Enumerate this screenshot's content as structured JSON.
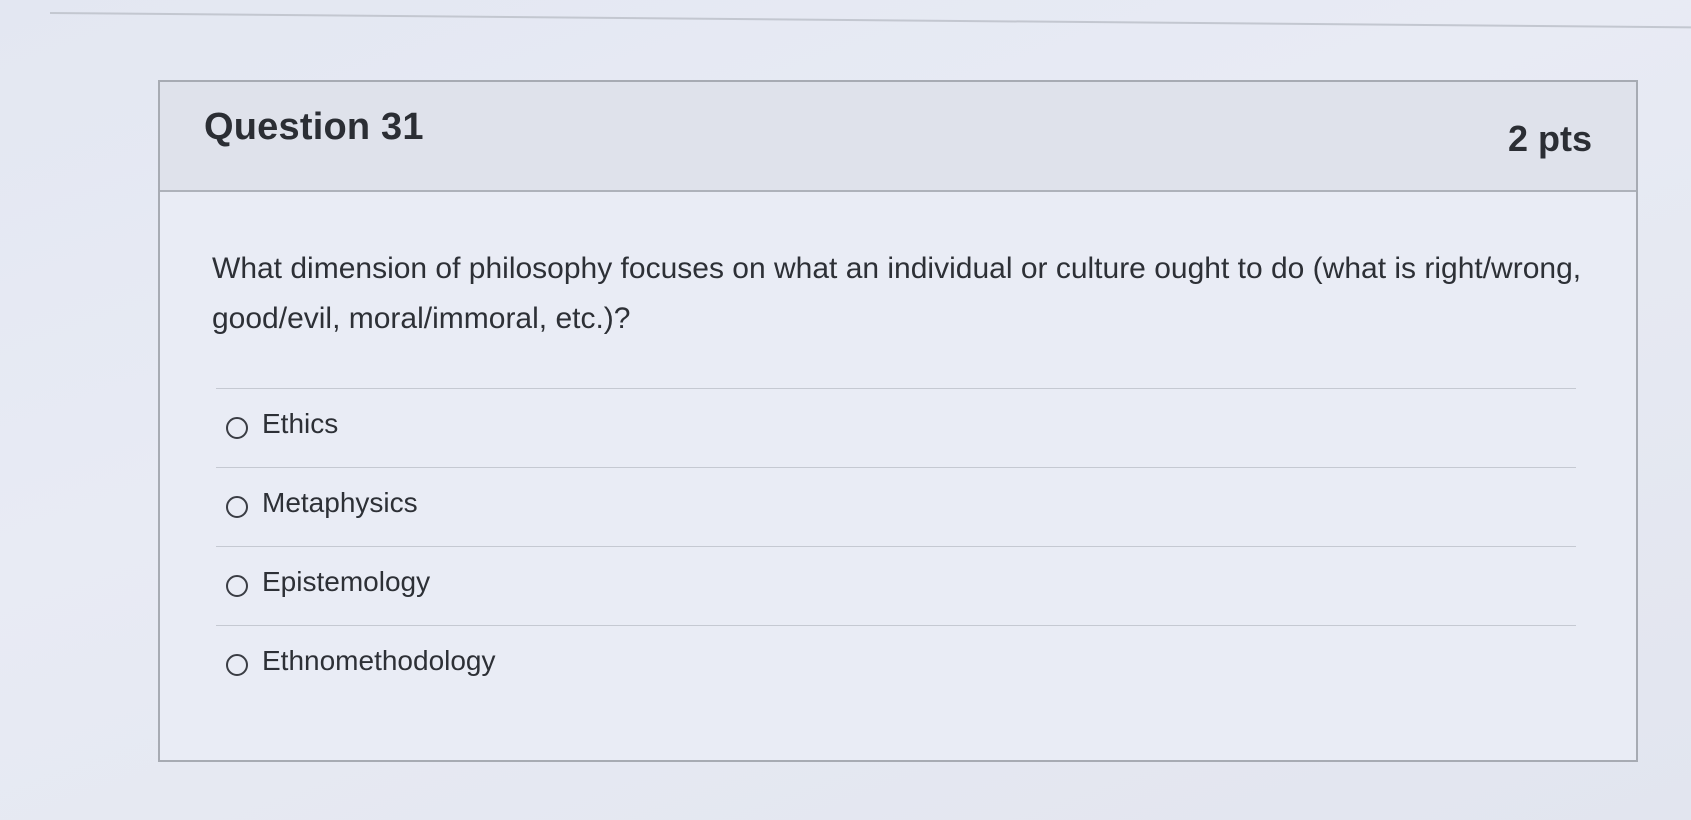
{
  "question": {
    "title": "Question 31",
    "points": "2 pts",
    "text": "What dimension of philosophy focuses on what an individual or culture ought to do (what is right/wrong, good/evil, moral/immoral, etc.)?",
    "answers": [
      {
        "label": "Ethics",
        "selected": false
      },
      {
        "label": "Metaphysics",
        "selected": false
      },
      {
        "label": "Epistemology",
        "selected": false
      },
      {
        "label": "Ethnomethodology",
        "selected": false
      }
    ]
  }
}
